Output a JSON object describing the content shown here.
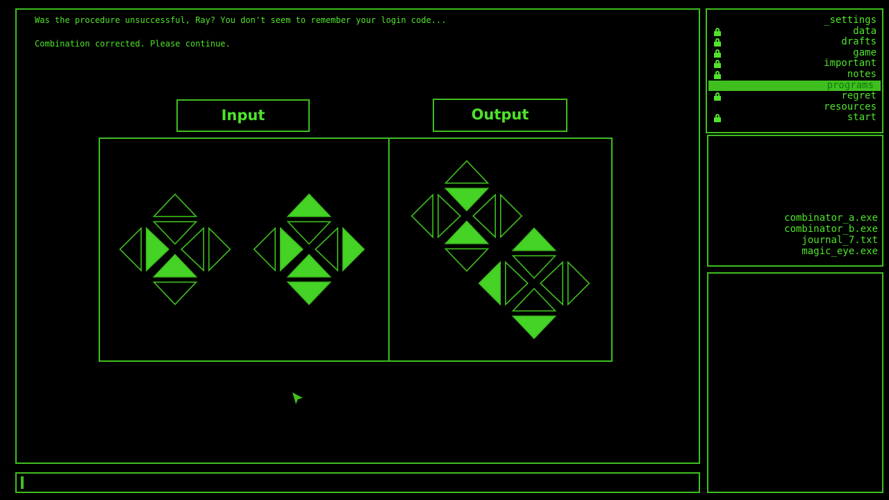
{
  "messages": [
    "Was the procedure unsuccessful, Ray? You don't seem to remember your login code...",
    "Combination corrected. Please continue."
  ],
  "puzzle": {
    "input_label": "Input",
    "output_label": "Output"
  },
  "directories": [
    {
      "name": "_settings",
      "locked": false,
      "selected": false
    },
    {
      "name": "data",
      "locked": true,
      "selected": false
    },
    {
      "name": "drafts",
      "locked": true,
      "selected": false
    },
    {
      "name": "game",
      "locked": true,
      "selected": false
    },
    {
      "name": "important",
      "locked": true,
      "selected": false
    },
    {
      "name": "notes",
      "locked": true,
      "selected": false
    },
    {
      "name": "programs",
      "locked": false,
      "selected": true
    },
    {
      "name": "regret",
      "locked": true,
      "selected": false
    },
    {
      "name": "resources",
      "locked": false,
      "selected": false
    },
    {
      "name": "start",
      "locked": true,
      "selected": false
    }
  ],
  "files": [
    "combinator_a.exe",
    "combinator_b.exe",
    "journal_7.txt",
    "magic_eye.exe"
  ],
  "colors": {
    "primary": "#4fe32a",
    "border": "#3fbf1f",
    "fill": "#45d325",
    "selected_text": "#147a0c",
    "background": "#000000"
  }
}
